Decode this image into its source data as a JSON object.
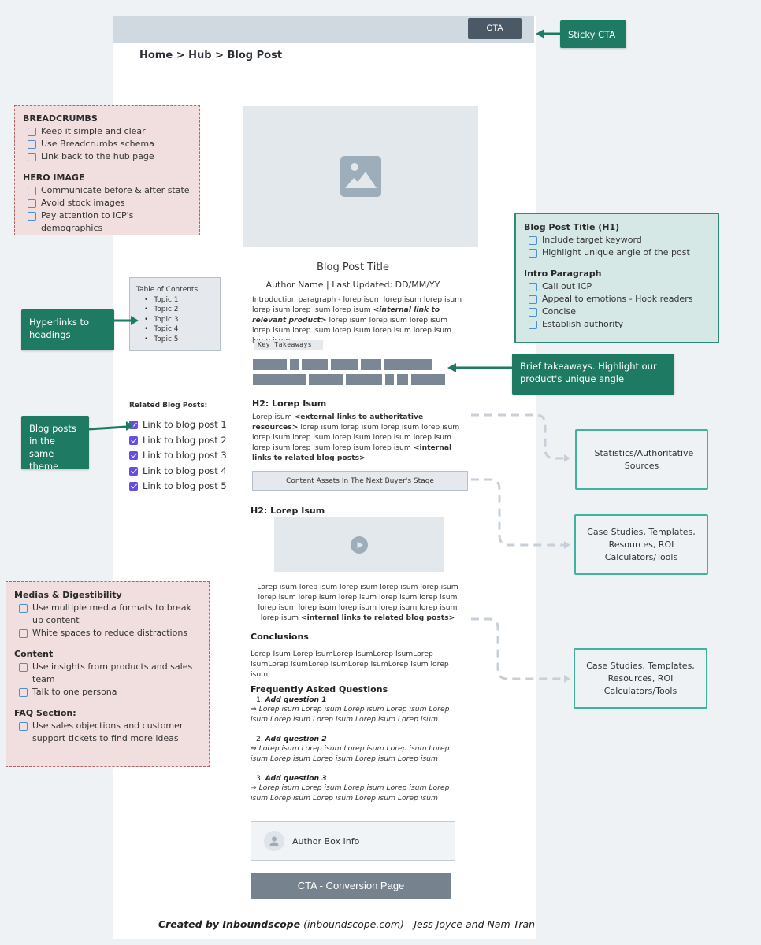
{
  "header": {
    "cta_label": "CTA",
    "breadcrumb": "Home > Hub  > Blog Post"
  },
  "annotations": {
    "sticky_cta": "Sticky CTA",
    "hyperlinks": "Hyperlinks to headings",
    "blog_posts_theme": "Blog posts in the same theme",
    "brief_takeaways": "Brief takeaways. Highlight our product's unique angle"
  },
  "checklist_top_left": {
    "sections": [
      {
        "title": "BREADCRUMBS",
        "items": [
          "Keep it simple and clear",
          "Use Breadcrumbs schema",
          "Link back to the hub page"
        ]
      },
      {
        "title": "HERO IMAGE",
        "items": [
          "Communicate before & after state",
          "Avoid stock images",
          "Pay attention to ICP's demographics"
        ]
      }
    ]
  },
  "checklist_right": {
    "sections": [
      {
        "title": "Blog Post Title (H1)",
        "items": [
          "Include target keyword",
          "Highlight unique angle of the post"
        ]
      },
      {
        "title": "Intro Paragraph",
        "items": [
          "Call out ICP",
          "Appeal to emotions - Hook readers",
          "Concise",
          "Establish authority"
        ]
      }
    ]
  },
  "checklist_bottom_left": {
    "sections": [
      {
        "title": "Medias & Digestibility",
        "items": [
          "Use multiple media formats to break up content",
          "White spaces to reduce distractions"
        ]
      },
      {
        "title": "Content",
        "items": [
          "Use insights from products and sales team",
          "Talk to one persona"
        ]
      },
      {
        "title": "FAQ Section:",
        "items": [
          "Use sales objections and customer support tickets to find more ideas"
        ]
      }
    ]
  },
  "post": {
    "hero_icon": "image-placeholder-icon",
    "title": "Blog Post Title",
    "author_line": "Author Name   | Last Updated: DD/MM/YY",
    "intro_pre": "Introduction paragraph  - lorep isum lorep isum lorep isum lorep isum lorep isum lorep isum ",
    "intro_link": "<internal link to relevant product>",
    "intro_post": " lorep isum  lorep isum  lorep isum  lorep isum lorep isum lorep isum lorep isum lorep isum lorep isum",
    "key_takeaways": "Key Takeaways:",
    "toc": {
      "title": "Table of Contents",
      "topics": [
        "Topic 1",
        "Topic 2",
        "Topic 3",
        "Topic 4",
        "Topic 5"
      ]
    },
    "related": {
      "title": "Related Blog Posts:",
      "links": [
        "Link to blog post 1",
        "Link to blog post 2",
        "Link to blog post 3",
        "Link to blog post 4",
        "Link to blog post 5"
      ]
    },
    "section1": {
      "heading": "H2: Lorep Isum",
      "pre": "Lorep isum ",
      "ext_link": "<external links to authoritative resources>",
      "mid": " lorep isum  lorep isum  lorep isum  lorep isum  lorep isum lorep isum  lorep isum  lorep isum  lorep isum  lorep isum lorep isum  lorep isum  lorep isum ",
      "int_link": "<internal links to related blog posts>"
    },
    "content_assets": "Content Assets In The Next Buyer's Stage",
    "section2": {
      "heading": "H2: Lorep Isum",
      "video_icon": "play-icon",
      "text": "Lorep isum lorep isum  lorep isum  lorep isum  lorep isum lorep isum  lorep isum  lorep isum  lorep isum  lorep isum lorep isum  lorep isum  lorep isum  lorep isum  lorep isum lorep isum ",
      "int_link": "<internal links to related blog posts>"
    },
    "conclusions": {
      "heading": "Conclusions",
      "text": "Lorep Isum Lorep IsumLorep IsumLorep IsumLorep IsumLorep IsumLorep IsumLorep IsumLorep Isum lorep isum"
    },
    "faq": {
      "heading": "Frequently Asked Questions",
      "items": [
        {
          "num": "1.",
          "q": "Add question 1",
          "a": "⇒ Lorep isum Lorep isum Lorep isum Lorep isum Lorep isum Lorep isum Lorep isum Lorep isum Lorep isum"
        },
        {
          "num": "2.",
          "q": "Add question 2",
          "a": "⇒ Lorep isum Lorep isum Lorep isum Lorep isum Lorep isum Lorep isum Lorep isum Lorep isum Lorep isum"
        },
        {
          "num": "3.",
          "q": "Add question 3",
          "a": "⇒ Lorep isum Lorep isum Lorep isum Lorep isum Lorep isum Lorep isum Lorep isum Lorep isum Lorep isum"
        }
      ]
    },
    "author_box": "Author Box Info",
    "cta_bottom": "CTA - Conversion Page"
  },
  "side_boxes": {
    "stats": "Statistics/Authoritative Sources",
    "case_studies_1": "Case Studies, Templates, Resources, ROI Calculators/Tools",
    "case_studies_2": "Case Studies, Templates, Resources, ROI Calculators/Tools"
  },
  "footer": {
    "bold": "Created by Inboundscope",
    "rest": " (inboundscope.com) - Jess Joyce and Nam Tran"
  },
  "colors": {
    "annotation_green": "#1f7a63",
    "pink_box": "#f1dfdf",
    "teal_box": "#d6e8e5",
    "checkbox_checked": "#6a4ce0"
  }
}
